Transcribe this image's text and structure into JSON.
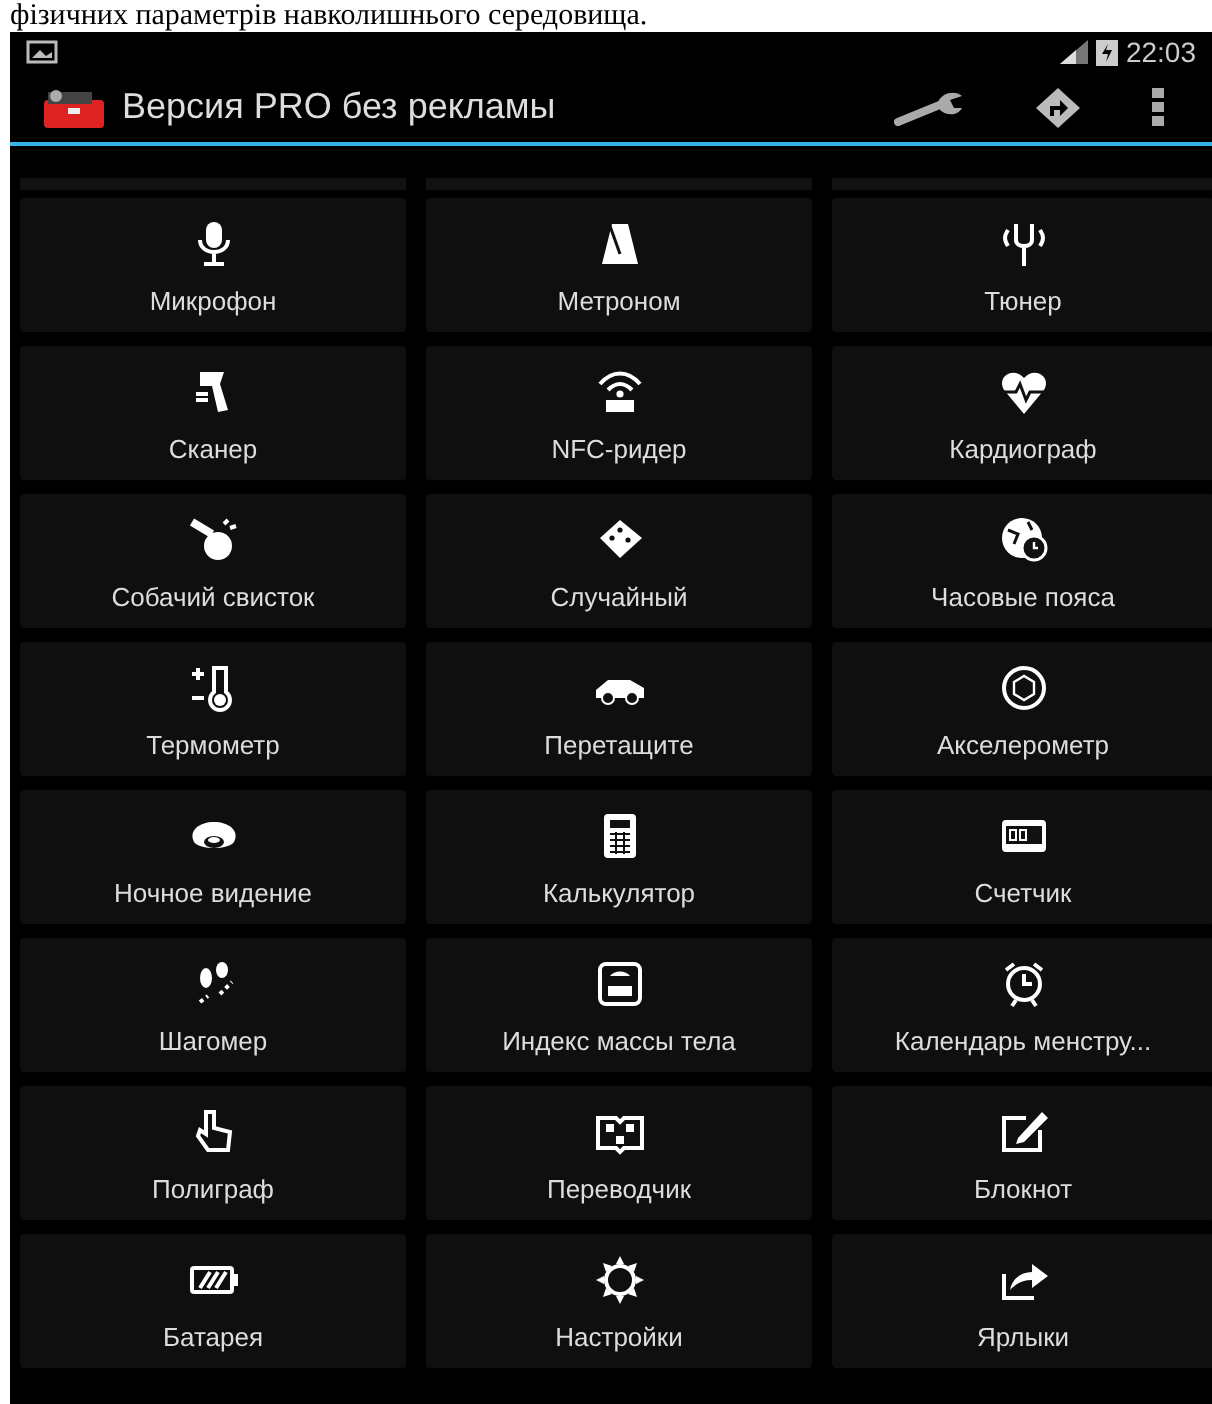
{
  "caption": "фізичних параметрів навколишнього середовища.",
  "status_bar": {
    "time": "22:03"
  },
  "action_bar": {
    "title": "Версия PRO без рекламы"
  },
  "tiles": [
    {
      "label": "Микрофон"
    },
    {
      "label": "Метроном"
    },
    {
      "label": "Тюнер"
    },
    {
      "label": "Сканер"
    },
    {
      "label": "NFC-ридер"
    },
    {
      "label": "Кардиограф"
    },
    {
      "label": "Собачий свисток"
    },
    {
      "label": "Случайный"
    },
    {
      "label": "Часовые пояса"
    },
    {
      "label": "Термометр"
    },
    {
      "label": "Перетащите"
    },
    {
      "label": "Акселерометр"
    },
    {
      "label": "Ночное видение"
    },
    {
      "label": "Калькулятор"
    },
    {
      "label": "Счетчик"
    },
    {
      "label": "Шагомер"
    },
    {
      "label": "Индекс массы тела"
    },
    {
      "label": "Календарь менстру..."
    },
    {
      "label": "Полиграф"
    },
    {
      "label": "Переводчик"
    },
    {
      "label": "Блокнот"
    },
    {
      "label": "Батарея"
    },
    {
      "label": "Настройки"
    },
    {
      "label": "Ярлыки"
    }
  ]
}
